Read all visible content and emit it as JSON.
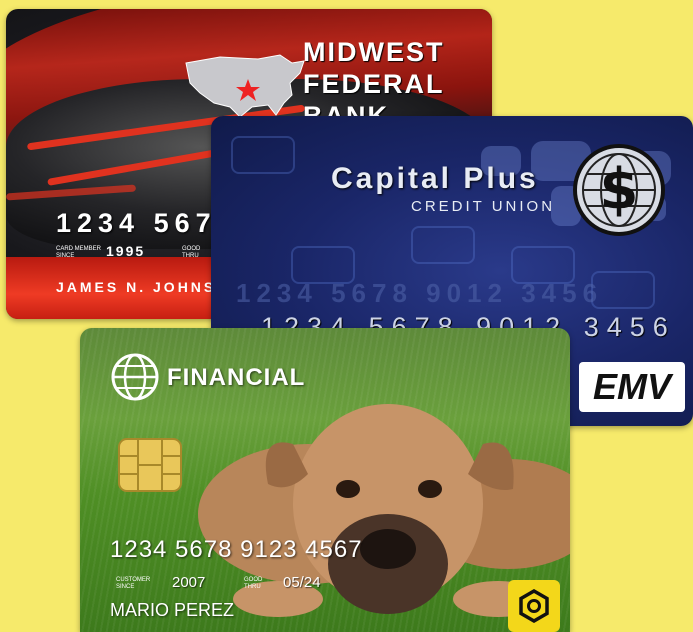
{
  "colors": {
    "background": "#f6ea6b",
    "mw_red": "#e0321f",
    "cp_blue": "#1a2668",
    "fin_green": "#4f8f25"
  },
  "cards": {
    "midwest": {
      "bank_line1": "Midwest",
      "bank_line2": "Federal",
      "bank_line3": "Bank",
      "number": "1234 567",
      "since_label": "CARD MEMBER SINCE",
      "since_value": "1995",
      "thru_label": "GOOD THRU",
      "holder": "JAMES N. JOHNS",
      "icon": "us-map-star-icon"
    },
    "capital": {
      "title": "Capital Plus",
      "subtitle": "CREDIT UNION",
      "number": "1234 5678 9012 3456",
      "ghost_number": "1234 5678 9012 3456",
      "badge": "EMV",
      "icon": "dollar-globe-logo-icon"
    },
    "financial": {
      "title": "FINANCIAL",
      "number": "1234 5678 9123 4567",
      "since_label": "CUSTOMER SINCE",
      "since_value": "2007",
      "thru_label": "GOOD THRU",
      "thru_value": "05/24",
      "holder": "MARIO PEREZ",
      "icon": "globe-logo-icon"
    }
  }
}
